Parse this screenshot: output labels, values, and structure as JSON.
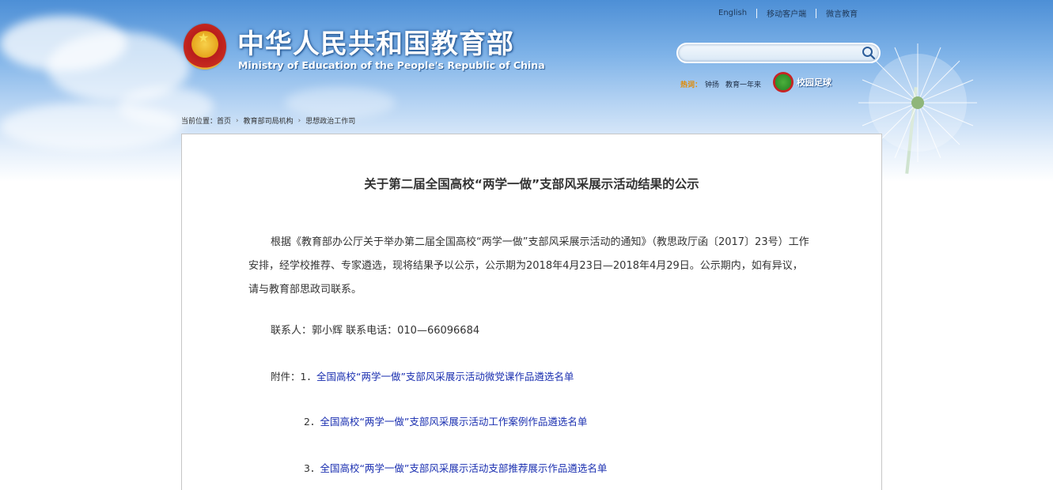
{
  "header": {
    "title": "中华人民共和国教育部",
    "subtitle": "Ministry of Education of the People's Republic of China",
    "top_links": [
      "English",
      "移动客户端",
      "微言教育"
    ],
    "search": {
      "placeholder": "",
      "value": ""
    },
    "hot": {
      "label": "热词：",
      "items": [
        "钟扬",
        "教育一年来"
      ]
    },
    "campus_football": "校园足球"
  },
  "breadcrumb": {
    "prefix": "当前位置：",
    "items": [
      "首页",
      "教育部司局机构",
      "思想政治工作司"
    ]
  },
  "article": {
    "title": "关于第二届全国高校“两学一做”支部风采展示活动结果的公示",
    "body": "根据《教育部办公厅关于举办第二届全国高校“两学一做”支部风采展示活动的通知》（教思政厅函〔2017〕23号）工作安排，经学校推荐、专家遴选，现将结果予以公示，公示期为2018年4月23日—2018年4月29日。公示期内，如有异议，请与教育部思政司联系。",
    "contact": "联系人：郭小辉 联系电话：010—66096684",
    "attachments_prefix": "附件：",
    "attachments": [
      {
        "num": "1．",
        "title": "全国高校“两学一做”支部风采展示活动微党课作品遴选名单"
      },
      {
        "num": "2．",
        "title": "全国高校“两学一做”支部风采展示活动工作案例作品遴选名单"
      },
      {
        "num": "3．",
        "title": "全国高校“两学一做”支部风采展示活动支部推荐展示作品遴选名单"
      }
    ]
  },
  "colors": {
    "link": "#1a2fb0",
    "hot_label": "#e28a00",
    "sky": "#4d8fd6"
  },
  "icons": [
    "national-emblem-icon",
    "search-icon",
    "campus-football-icon",
    "chevron-right-icon"
  ]
}
